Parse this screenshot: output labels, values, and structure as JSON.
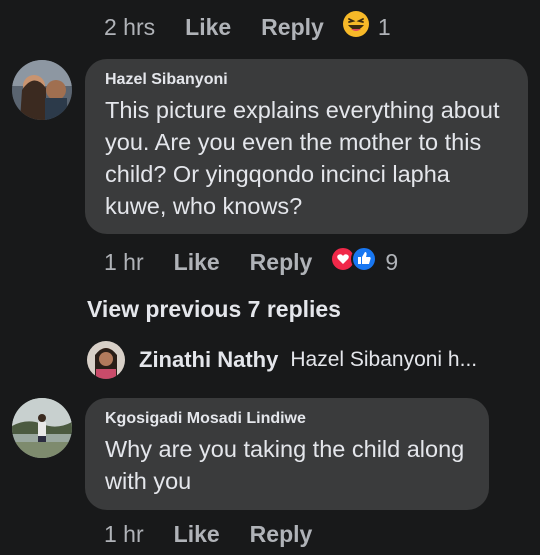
{
  "top_meta": {
    "time": "2 hrs",
    "like": "Like",
    "reply": "Reply",
    "count": "1"
  },
  "comment1": {
    "author": "Hazel Sibanyoni",
    "text": "This picture explains everything about you. Are you even the mother to this child? Or yingqondo incinci lapha kuwe, who knows?",
    "time": "1 hr",
    "like": "Like",
    "reply": "Reply",
    "count": "9"
  },
  "view_previous": "View previous 7 replies",
  "preview_reply": {
    "author": "Zinathi Nathy",
    "snippet": "Hazel Sibanyoni h..."
  },
  "comment2": {
    "author": "Kgosigadi Mosadi Lindiwe",
    "text": "Why are you taking the child along with you",
    "time": "1 hr",
    "like": "Like",
    "reply": "Reply"
  },
  "colors": {
    "background": "#18191a",
    "bubble": "#3a3b3c",
    "like_blue": "#1877f2",
    "love_red": "#f02849",
    "haha_yellow": "#f7b928"
  },
  "icons": [
    "haha-reaction-icon",
    "love-reaction-icon",
    "like-reaction-icon"
  ]
}
